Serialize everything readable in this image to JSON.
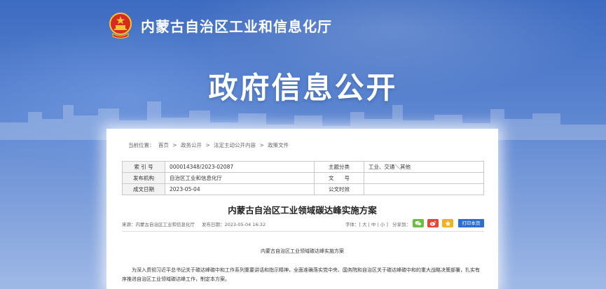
{
  "site": {
    "title": "内蒙古自治区工业和信息化厅",
    "hero_title": "政府信息公开"
  },
  "breadcrumb": {
    "prefix": "当前位置：",
    "items": [
      "首页",
      ">",
      "政务公开",
      ">",
      "法定主动公开内容",
      ">",
      "政策文件"
    ]
  },
  "meta_table": {
    "rows": [
      {
        "label1": "索 引 号",
        "value1": "000014348/2023-02087",
        "label2": "主题分类",
        "value2": "工业、交通＼其他"
      },
      {
        "label1": "发布机构",
        "value1": "自治区工业和信息化厅",
        "label2": "文　　号",
        "value2": ""
      },
      {
        "label1": "成文日期",
        "value1": "2023-05-04",
        "label2": "公文时效",
        "value2": ""
      }
    ]
  },
  "article": {
    "title": "内蒙古自治区工业领域碳达峰实施方案",
    "source": "来源：内蒙古自治区工业和信息化厅",
    "publish_time": "发布日期：2023-05-04 16:32",
    "font_size_label": "字体：[ 大 | 中 | 小 ]",
    "share_label": "分享到：",
    "print_label": "打印本页",
    "body_title": "内蒙古自治区工业领域碳达峰实施方案",
    "body_paragraph": "为深入贯彻习近平总书记关于碳达峰碳中和工作系列重要讲话和指示精神，全面准确落实党中央、国务院和自治区关于碳达峰碳中和的重大战略决策部署，扎实有序推进自治区工业领域碳达峰工作，制定本方案。"
  },
  "icons": {
    "emblem": "national-emblem-icon",
    "wechat": "wechat-icon",
    "weibo": "weibo-icon",
    "favorite": "star-icon"
  },
  "colors": {
    "hero_blue": "#4a75c6",
    "print_button": "#2f6ed0",
    "wechat": "#6cbd45",
    "weibo": "#e6453a",
    "favorite": "#f0b31c"
  }
}
